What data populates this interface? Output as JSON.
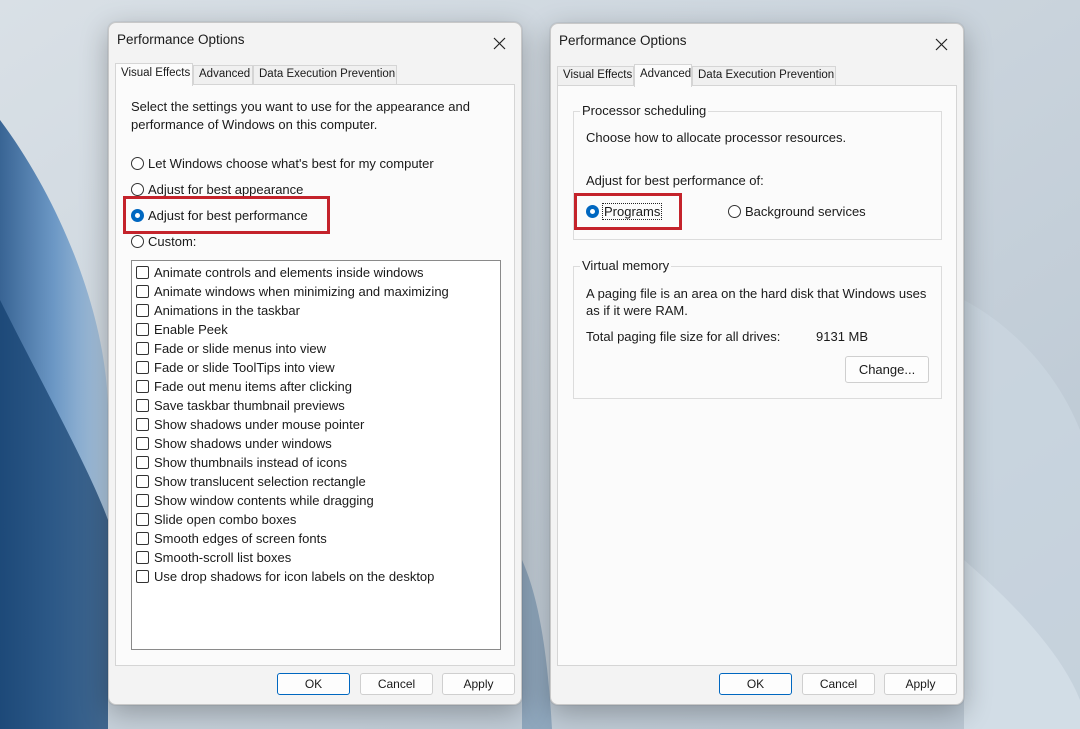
{
  "dialogs": {
    "left": {
      "title": "Performance Options",
      "tabs": [
        "Visual Effects",
        "Advanced",
        "Data Execution Prevention"
      ],
      "active_tab": "Visual Effects",
      "description_line1": "Select the settings you want to use for the appearance and",
      "description_line2": "performance of Windows on this computer.",
      "options": [
        {
          "label": "Let Windows choose what's best for my computer",
          "selected": false
        },
        {
          "label": "Adjust for best appearance",
          "selected": false
        },
        {
          "label": "Adjust for best performance",
          "selected": true
        },
        {
          "label": "Custom:",
          "selected": false
        }
      ],
      "effects": [
        "Animate controls and elements inside windows",
        "Animate windows when minimizing and maximizing",
        "Animations in the taskbar",
        "Enable Peek",
        "Fade or slide menus into view",
        "Fade or slide ToolTips into view",
        "Fade out menu items after clicking",
        "Save taskbar thumbnail previews",
        "Show shadows under mouse pointer",
        "Show shadows under windows",
        "Show thumbnails instead of icons",
        "Show translucent selection rectangle",
        "Show window contents while dragging",
        "Slide open combo boxes",
        "Smooth edges of screen fonts",
        "Smooth-scroll list boxes",
        "Use drop shadows for icon labels on the desktop"
      ],
      "buttons": {
        "ok": "OK",
        "cancel": "Cancel",
        "apply": "Apply"
      }
    },
    "right": {
      "title": "Performance Options",
      "tabs": [
        "Visual Effects",
        "Advanced",
        "Data Execution Prevention"
      ],
      "active_tab": "Advanced",
      "processor_scheduling": {
        "title": "Processor scheduling",
        "description": "Choose how to allocate processor resources.",
        "adjust_label": "Adjust for best performance of:",
        "options": [
          {
            "label": "Programs",
            "selected": true
          },
          {
            "label": "Background services",
            "selected": false
          }
        ]
      },
      "virtual_memory": {
        "title": "Virtual memory",
        "description_line1": "A paging file is an area on the hard disk that Windows uses",
        "description_line2": "as if it were RAM.",
        "total_label": "Total paging file size for all drives:",
        "total_value": "9131 MB",
        "change_button": "Change..."
      },
      "buttons": {
        "ok": "OK",
        "cancel": "Cancel",
        "apply": "Apply"
      }
    }
  },
  "colors": {
    "accent": "#0067c0",
    "highlight": "#c4232b"
  }
}
